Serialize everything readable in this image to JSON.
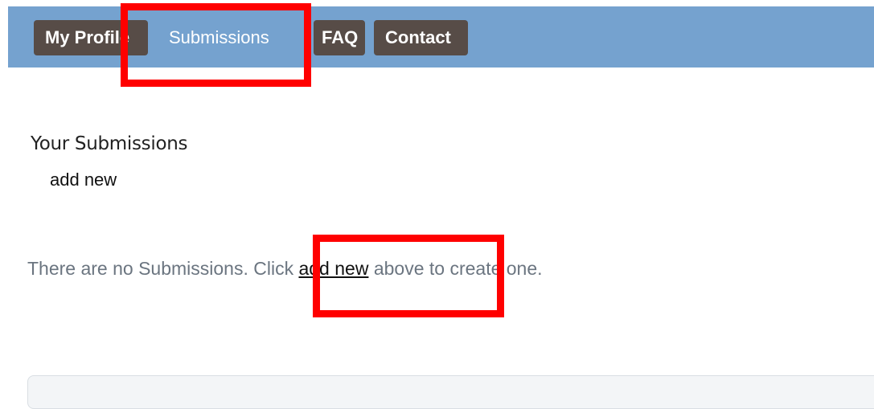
{
  "nav": {
    "tabs": [
      {
        "label": "My Profile"
      },
      {
        "label": "Submissions"
      },
      {
        "label": "FAQ"
      },
      {
        "label": "Contact"
      }
    ]
  },
  "main": {
    "section_title": "Your Submissions",
    "add_new_label": "add new",
    "empty_message": {
      "before": "There are no Submissions. Click ",
      "link": "add new",
      "after": " above to create one."
    }
  },
  "colors": {
    "navbar": "#75a2cf",
    "tab_dark": "#574c47",
    "highlight": "#ff0000",
    "message_text": "#6b7580"
  }
}
